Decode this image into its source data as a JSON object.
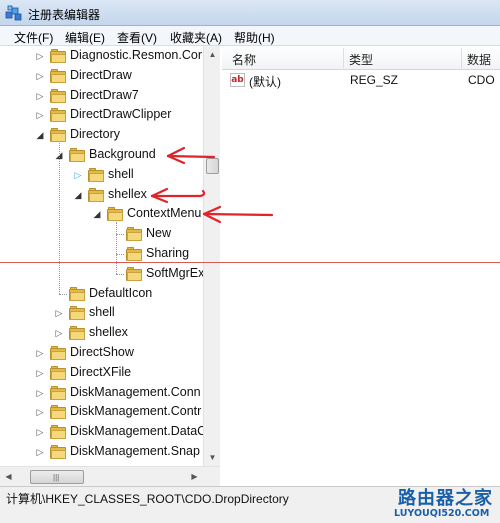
{
  "window": {
    "title": "注册表编辑器"
  },
  "menu": [
    "文件(F)",
    "编辑(E)",
    "查看(V)",
    "收藏夹(A)",
    "帮助(H)"
  ],
  "tree": {
    "rows": [
      {
        "label": "Diagnostic.Resmon.Cor",
        "level": 0,
        "expander": "collapsed"
      },
      {
        "label": "DirectDraw",
        "level": 0,
        "expander": "collapsed"
      },
      {
        "label": "DirectDraw7",
        "level": 0,
        "expander": "collapsed"
      },
      {
        "label": "DirectDrawClipper",
        "level": 0,
        "expander": "collapsed"
      },
      {
        "label": "Directory",
        "level": 0,
        "expander": "expanded"
      },
      {
        "label": "Background",
        "level": 1,
        "expander": "expanded"
      },
      {
        "label": "shell",
        "level": 2,
        "expander": "collapsed-hover"
      },
      {
        "label": "shellex",
        "level": 2,
        "expander": "expanded"
      },
      {
        "label": "ContextMenu",
        "level": 3,
        "expander": "expanded"
      },
      {
        "label": "New",
        "level": 4,
        "expander": "none"
      },
      {
        "label": "Sharing",
        "level": 4,
        "expander": "none"
      },
      {
        "label": "SoftMgrEx",
        "level": 4,
        "expander": "none"
      },
      {
        "label": "DefaultIcon",
        "level": 1,
        "expander": "none"
      },
      {
        "label": "shell",
        "level": 1,
        "expander": "collapsed"
      },
      {
        "label": "shellex",
        "level": 1,
        "expander": "collapsed"
      },
      {
        "label": "DirectShow",
        "level": 0,
        "expander": "collapsed"
      },
      {
        "label": "DirectXFile",
        "level": 0,
        "expander": "collapsed"
      },
      {
        "label": "DiskManagement.Conn",
        "level": 0,
        "expander": "collapsed"
      },
      {
        "label": "DiskManagement.Contr",
        "level": 0,
        "expander": "collapsed"
      },
      {
        "label": "DiskManagement.DataC",
        "level": 0,
        "expander": "collapsed"
      },
      {
        "label": "DiskManagement.Snap",
        "level": 0,
        "expander": "collapsed"
      }
    ]
  },
  "list": {
    "columns": [
      "名称",
      "类型",
      "数据"
    ],
    "rows": [
      {
        "icon": "string-value-icon",
        "icon_text": "ab",
        "name": "(默认)",
        "type": "REG_SZ",
        "data": "CDO"
      }
    ]
  },
  "statusbar": {
    "path": "计算机\\HKEY_CLASSES_ROOT\\CDO.DropDirectory"
  },
  "annotations": {
    "color": "#e0242a",
    "arrows": [
      "Background",
      "shellex",
      "ContextMenu"
    ]
  },
  "watermark": {
    "text": "路由器之家",
    "url": "LUYOUQI520.COM"
  },
  "colors": {
    "folder": "#e3b94a",
    "titlebar": "#c4d6ec",
    "watermark": "#1a5fa8"
  }
}
